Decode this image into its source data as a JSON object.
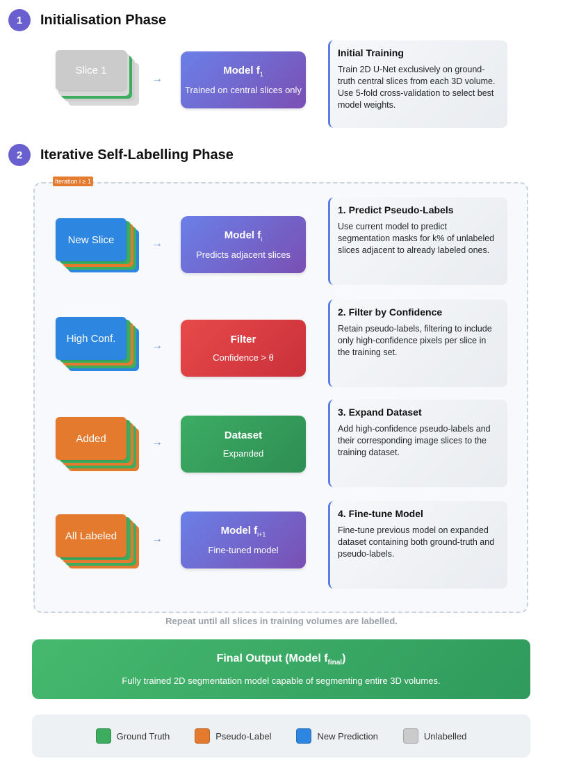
{
  "colors": {
    "ground_truth": "#3cac5f",
    "pseudo_label": "#e37a2e",
    "new_prediction": "#2d86e0",
    "unlabelled": "#cbcbcb",
    "phase_accent": "#6a5fcf"
  },
  "phase1": {
    "num": "1",
    "title": "Initialisation Phase",
    "stack_label": "Slice 1",
    "arrow": "→",
    "model_title": "Model f",
    "model_sub_index": "1",
    "model_sub": "Trained on central slices only",
    "card_title": "Initial Training",
    "card_body": "Train 2D U-Net exclusively on ground-truth central slices from each 3D volume. Use 5-fold cross-validation to select best model weights."
  },
  "phase2": {
    "num": "2",
    "title": "Iterative Self-Labelling Phase",
    "iteration_badge": "Iteration i ≥ 1",
    "steps": [
      {
        "stack_label": "New Slice",
        "arrow": "→",
        "box_title": "Model f",
        "box_title_sub": "i",
        "box_sub": "Predicts adjacent slices",
        "card_title": "1. Predict Pseudo-Labels",
        "card_body": "Use current model to predict segmentation masks for k% of unlabeled slices adjacent to already labeled ones."
      },
      {
        "stack_label": "High Conf.",
        "arrow": "→",
        "box_title": "Filter",
        "box_sub": "Confidence > θ",
        "card_title": "2. Filter by Confidence",
        "card_body": "Retain pseudo-labels, filtering to include only high-confidence pixels per slice in the training set."
      },
      {
        "stack_label": "Added",
        "arrow": "→",
        "box_title": "Dataset",
        "box_sub": "Expanded",
        "card_title": "3. Expand Dataset",
        "card_body": "Add high-confidence pseudo-labels and their corresponding image slices to the training dataset."
      },
      {
        "stack_label": "All Labeled",
        "arrow": "→",
        "box_title": "Model f",
        "box_title_sub": "i+1",
        "box_sub": "Fine-tuned model",
        "card_title": "4. Fine-tune Model",
        "card_body": "Fine-tune previous model on expanded dataset containing both ground-truth and pseudo-labels."
      }
    ],
    "repeat_note": "Repeat until all slices in training volumes are labelled."
  },
  "final": {
    "title": "Final Output (Model f",
    "title_sub": "final",
    "title_close": ")",
    "subtitle": "Fully trained 2D segmentation model capable of segmenting entire 3D volumes."
  },
  "legend": {
    "items": [
      {
        "label": "Ground Truth",
        "color": "#3cac5f"
      },
      {
        "label": "Pseudo-Label",
        "color": "#e37a2e"
      },
      {
        "label": "New Prediction",
        "color": "#2d86e0"
      },
      {
        "label": "Unlabelled",
        "color": "#cbcbcb"
      }
    ]
  }
}
